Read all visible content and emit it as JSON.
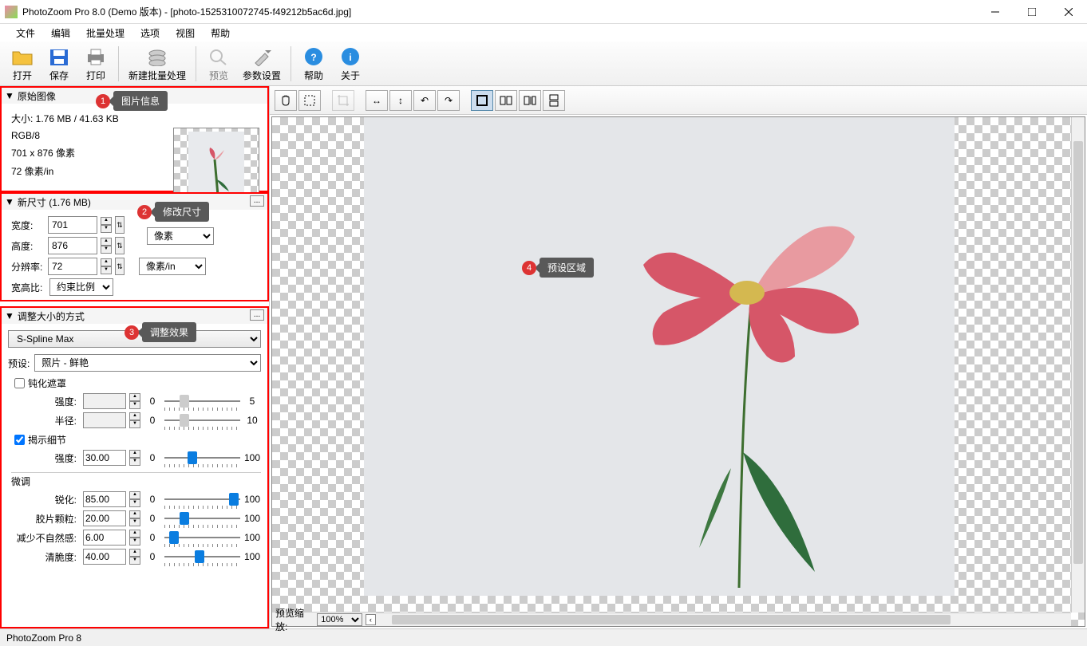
{
  "titlebar": {
    "text": "PhotoZoom Pro 8.0 (Demo 版本) - [photo-1525310072745-f49212b5ac6d.jpg]"
  },
  "menu": {
    "file": "文件",
    "edit": "编辑",
    "batch": "批量处理",
    "options": "选项",
    "view": "视图",
    "help": "帮助"
  },
  "toolbar": {
    "open": "打开",
    "save": "保存",
    "print": "打印",
    "newbatch": "新建批量处理",
    "preview": "预览",
    "settings": "参数设置",
    "help": "帮助",
    "about": "关于"
  },
  "panel1": {
    "title": "原始图像",
    "size_line": "大小: 1.76 MB / 41.63 KB",
    "colorspace": "RGB/8",
    "dims": "701 x 876 像素",
    "dpi": "72 像素/in"
  },
  "panel2": {
    "title": "新尺寸 (1.76 MB)",
    "width_label": "宽度:",
    "width_val": "701",
    "height_label": "高度:",
    "height_val": "876",
    "res_label": "分辨率:",
    "res_val": "72",
    "aspect_label": "宽高比:",
    "aspect_val": "约束比例",
    "unit_px": "像素",
    "unit_dpi": "像素/in"
  },
  "panel3": {
    "title": "调整大小的方式",
    "method": "S-Spline Max",
    "preset_label": "预设:",
    "preset_val": "照片 - 鲜艳",
    "unsharp": "钝化遮罩",
    "reveal": "揭示细节",
    "strength": "强度:",
    "radius": "半径:",
    "fine": "微调",
    "sharpen": "锐化:",
    "grain": "胶片颗粒:",
    "reduce": "减少不自然感:",
    "crisp": "清脆度:",
    "val_strength1": "",
    "val_radius": "",
    "val_strength2": "30.00",
    "val_sharpen": "85.00",
    "val_grain": "20.00",
    "val_reduce": "6.00",
    "val_crisp": "40.00",
    "min0": "0",
    "max5": "5",
    "max10": "10",
    "max100": "100"
  },
  "previewbar": {
    "zoom_label": "预览缩放:",
    "zoom_val": "100%"
  },
  "status": {
    "text": "PhotoZoom Pro 8"
  },
  "annotations": {
    "a1": "图片信息",
    "a2": "修改尺寸",
    "a3": "调整效果",
    "a4": "预设区域",
    "n1": "1",
    "n2": "2",
    "n3": "3",
    "n4": "4"
  }
}
